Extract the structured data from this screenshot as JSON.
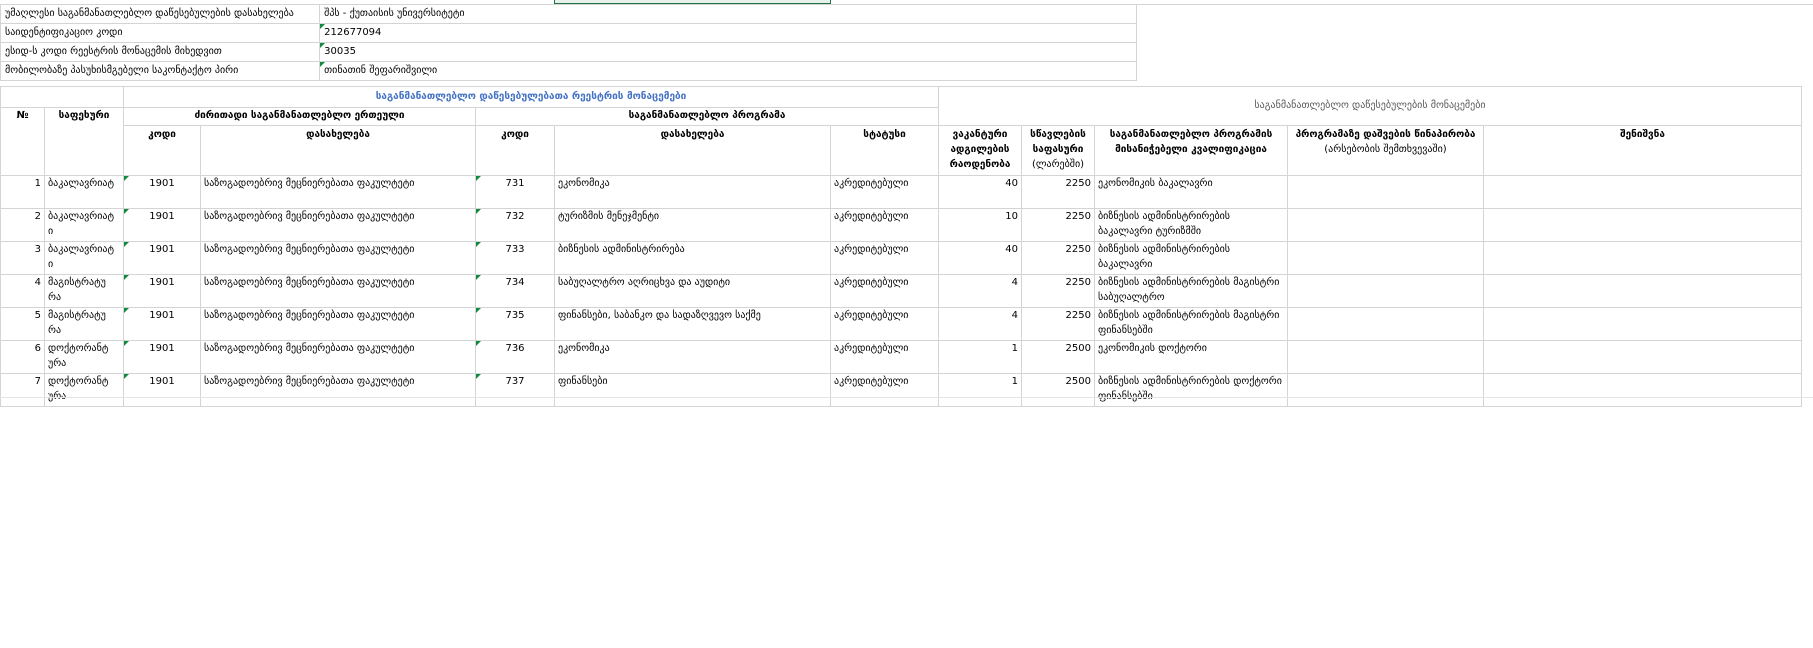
{
  "info": {
    "rows": [
      {
        "label": "უმაღლესი საგანმანათლებლო დაწესებულების დასახელება",
        "value": "შპს - ქუთაისის უნივერსიტეტი",
        "flag": false
      },
      {
        "label": "საიდენტიფიკაციო კოდი",
        "value": "212677094",
        "flag": true
      },
      {
        "label": "ესიდ-ს კოდი რეესტრის მონაცემის მიხედვით",
        "value": "30035",
        "flag": true
      },
      {
        "label": "მობილობაზე პასუხისმგებელი საკონტაქტო პირი",
        "value": "თინათინ შეფარიშვილი",
        "flag": true
      }
    ]
  },
  "table": {
    "section_registry": "საგანმანათლებლო დაწესებულებათა რეესტრის მონაცემები",
    "section_institution": "საგანმანათლებლო დაწესებულების მონაცემები",
    "group_unit": "ძირითადი საგანმანათლებლო ერთეული",
    "group_program": "საგანმანათლებლო პროგრამა",
    "col_num": "№",
    "col_level": "საფეხური",
    "col_code": "კოდი",
    "col_name": "დასახელება",
    "col_status": "სტატუსი",
    "col_vacant": "ვაკანტური ადგილების რაოდენობა",
    "col_fee": "სწავლების საფასური",
    "col_fee_note": "(ლარებში)",
    "col_qualification": "საგანმანათლებლო პროგრამის მისანიჭებელი კვალიფიკაცია",
    "col_admission": "პროგრამაზე დაშვების წინაპირობა",
    "col_admission_note": "(არსებობის შემთხვევაში)",
    "col_notes": "შენიშვნა",
    "rows": [
      {
        "num": "1",
        "level": "ბაკალავრიატ",
        "unit_code": "1901",
        "unit_name": "საზოგადოებრივ მეცნიერებათა ფაკულტეტი",
        "prog_code": "731",
        "prog_name": "ეკონომიკა",
        "status": "აკრედიტებული",
        "vacant": "40",
        "fee": "2250",
        "qualification": "ეკონომიკის ბაკალავრი",
        "admission": "",
        "notes": ""
      },
      {
        "num": "2",
        "level": "ბაკალავრიატ ი",
        "unit_code": "1901",
        "unit_name": "საზოგადოებრივ მეცნიერებათა ფაკულტეტი",
        "prog_code": "732",
        "prog_name": "ტურიზმის მენეჯმენტი",
        "status": "აკრედიტებული",
        "vacant": "10",
        "fee": "2250",
        "qualification": "ბიზნესის ადმინისტრირების ბაკალავრი ტურიზმში",
        "admission": "",
        "notes": ""
      },
      {
        "num": "3",
        "level": "ბაკალავრიატ ი",
        "unit_code": "1901",
        "unit_name": "საზოგადოებრივ მეცნიერებათა ფაკულტეტი",
        "prog_code": "733",
        "prog_name": "ბიზნესის ადმინისტრირება",
        "status": "აკრედიტებული",
        "vacant": "40",
        "fee": "2250",
        "qualification": "ბიზნესის ადმინისტრირების ბაკალავრი",
        "admission": "",
        "notes": ""
      },
      {
        "num": "4",
        "level": "მაგისტრატუ რა",
        "unit_code": "1901",
        "unit_name": "საზოგადოებრივ მეცნიერებათა ფაკულტეტი",
        "prog_code": "734",
        "prog_name": "საბუღალტრო აღრიცხვა და აუდიტი",
        "status": "აკრედიტებული",
        "vacant": "4",
        "fee": "2250",
        "qualification": "ბიზნესის ადმინისტრირების მაგისტრი საბუღალტრო",
        "admission": "",
        "notes": ""
      },
      {
        "num": "5",
        "level": "მაგისტრატუ რა",
        "unit_code": "1901",
        "unit_name": "საზოგადოებრივ მეცნიერებათა ფაკულტეტი",
        "prog_code": "735",
        "prog_name": "ფინანსები, საბანკო და სადაზღვევო საქმე",
        "status": "აკრედიტებული",
        "vacant": "4",
        "fee": "2250",
        "qualification": "ბიზნესის ადმინისტრირების მაგისტრი ფინანსებში",
        "admission": "",
        "notes": ""
      },
      {
        "num": "6",
        "level": "დოქტორანტ ურა",
        "unit_code": "1901",
        "unit_name": "საზოგადოებრივ მეცნიერებათა ფაკულტეტი",
        "prog_code": "736",
        "prog_name": "ეკონომიკა",
        "status": "აკრედიტებული",
        "vacant": "1",
        "fee": "2500",
        "qualification": "ეკონომიკის დოქტორი",
        "admission": "",
        "notes": ""
      },
      {
        "num": "7",
        "level": "დოქტორანტ ურა",
        "unit_code": "1901",
        "unit_name": "საზოგადოებრივ მეცნიერებათა ფაკულტეტი",
        "prog_code": "737",
        "prog_name": "ფინანსები",
        "status": "აკრედიტებული",
        "vacant": "1",
        "fee": "2500",
        "qualification": "ბიზნესის ადმინისტრირების დოქტორი ფინანსებში",
        "admission": "",
        "notes": ""
      }
    ]
  },
  "colors": {
    "section_title": "#4472c4",
    "grid": "#d4d4d4",
    "comment_marker": "#0f8a3e"
  }
}
